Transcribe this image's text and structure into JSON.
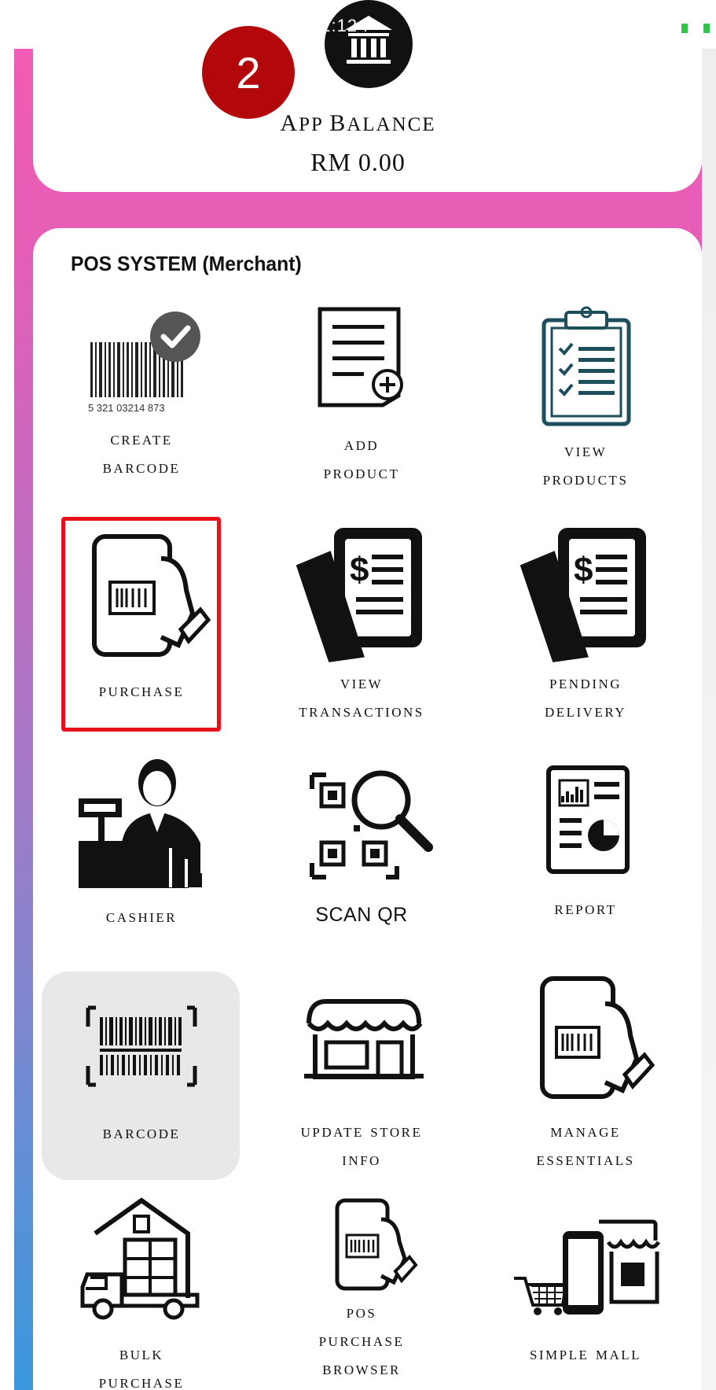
{
  "status_bar": {
    "time_text": "12:12 P"
  },
  "balance": {
    "label_first": "A",
    "label_rest": "PP ",
    "label_second_first": "B",
    "label_second_rest": "ALANCE",
    "value": "RM 0.00",
    "badge": "2"
  },
  "pos": {
    "title": "POS SYSTEM (Merchant)",
    "tiles": [
      {
        "line1": "Create",
        "line2": "Barcode",
        "icon": "barcode-check-icon"
      },
      {
        "line1": "Add",
        "line2": "Product",
        "icon": "add-product-icon"
      },
      {
        "line1": "View",
        "line2": "Products",
        "icon": "clipboard-checklist-icon"
      },
      {
        "line1": "Purchase",
        "line2": "",
        "icon": "phone-scan-icon"
      },
      {
        "line1": "View",
        "line2": "Transactions",
        "icon": "transactions-icon"
      },
      {
        "line1": "Pending",
        "line2": "Delivery",
        "icon": "pending-delivery-icon"
      },
      {
        "line1": "Cashier",
        "line2": "",
        "icon": "cashier-icon"
      },
      {
        "line1": "SCAN QR",
        "line2": "",
        "icon": "scan-qr-icon"
      },
      {
        "line1": "Report",
        "line2": "",
        "icon": "report-icon"
      },
      {
        "line1": "Barcode",
        "line2": "",
        "icon": "barcode-scan-icon"
      },
      {
        "line1": "Update Store",
        "line2": "Info",
        "icon": "store-icon"
      },
      {
        "line1": "Manage",
        "line2": "Essentials",
        "icon": "phone-scan-icon"
      },
      {
        "line1": "Bulk",
        "line2": "Purchase",
        "icon": "warehouse-truck-icon"
      },
      {
        "line1": "POS",
        "line2": "Purchase",
        "line3": "Browser",
        "icon": "phone-scan-icon"
      },
      {
        "line1": "Simple Mall",
        "line2": "",
        "icon": "simple-mall-icon"
      }
    ]
  },
  "colors": {
    "badge": "#b3080b",
    "highlight": "#e8101a",
    "gradient_top": "#f25cb4",
    "gradient_bottom": "#3b98dc"
  }
}
